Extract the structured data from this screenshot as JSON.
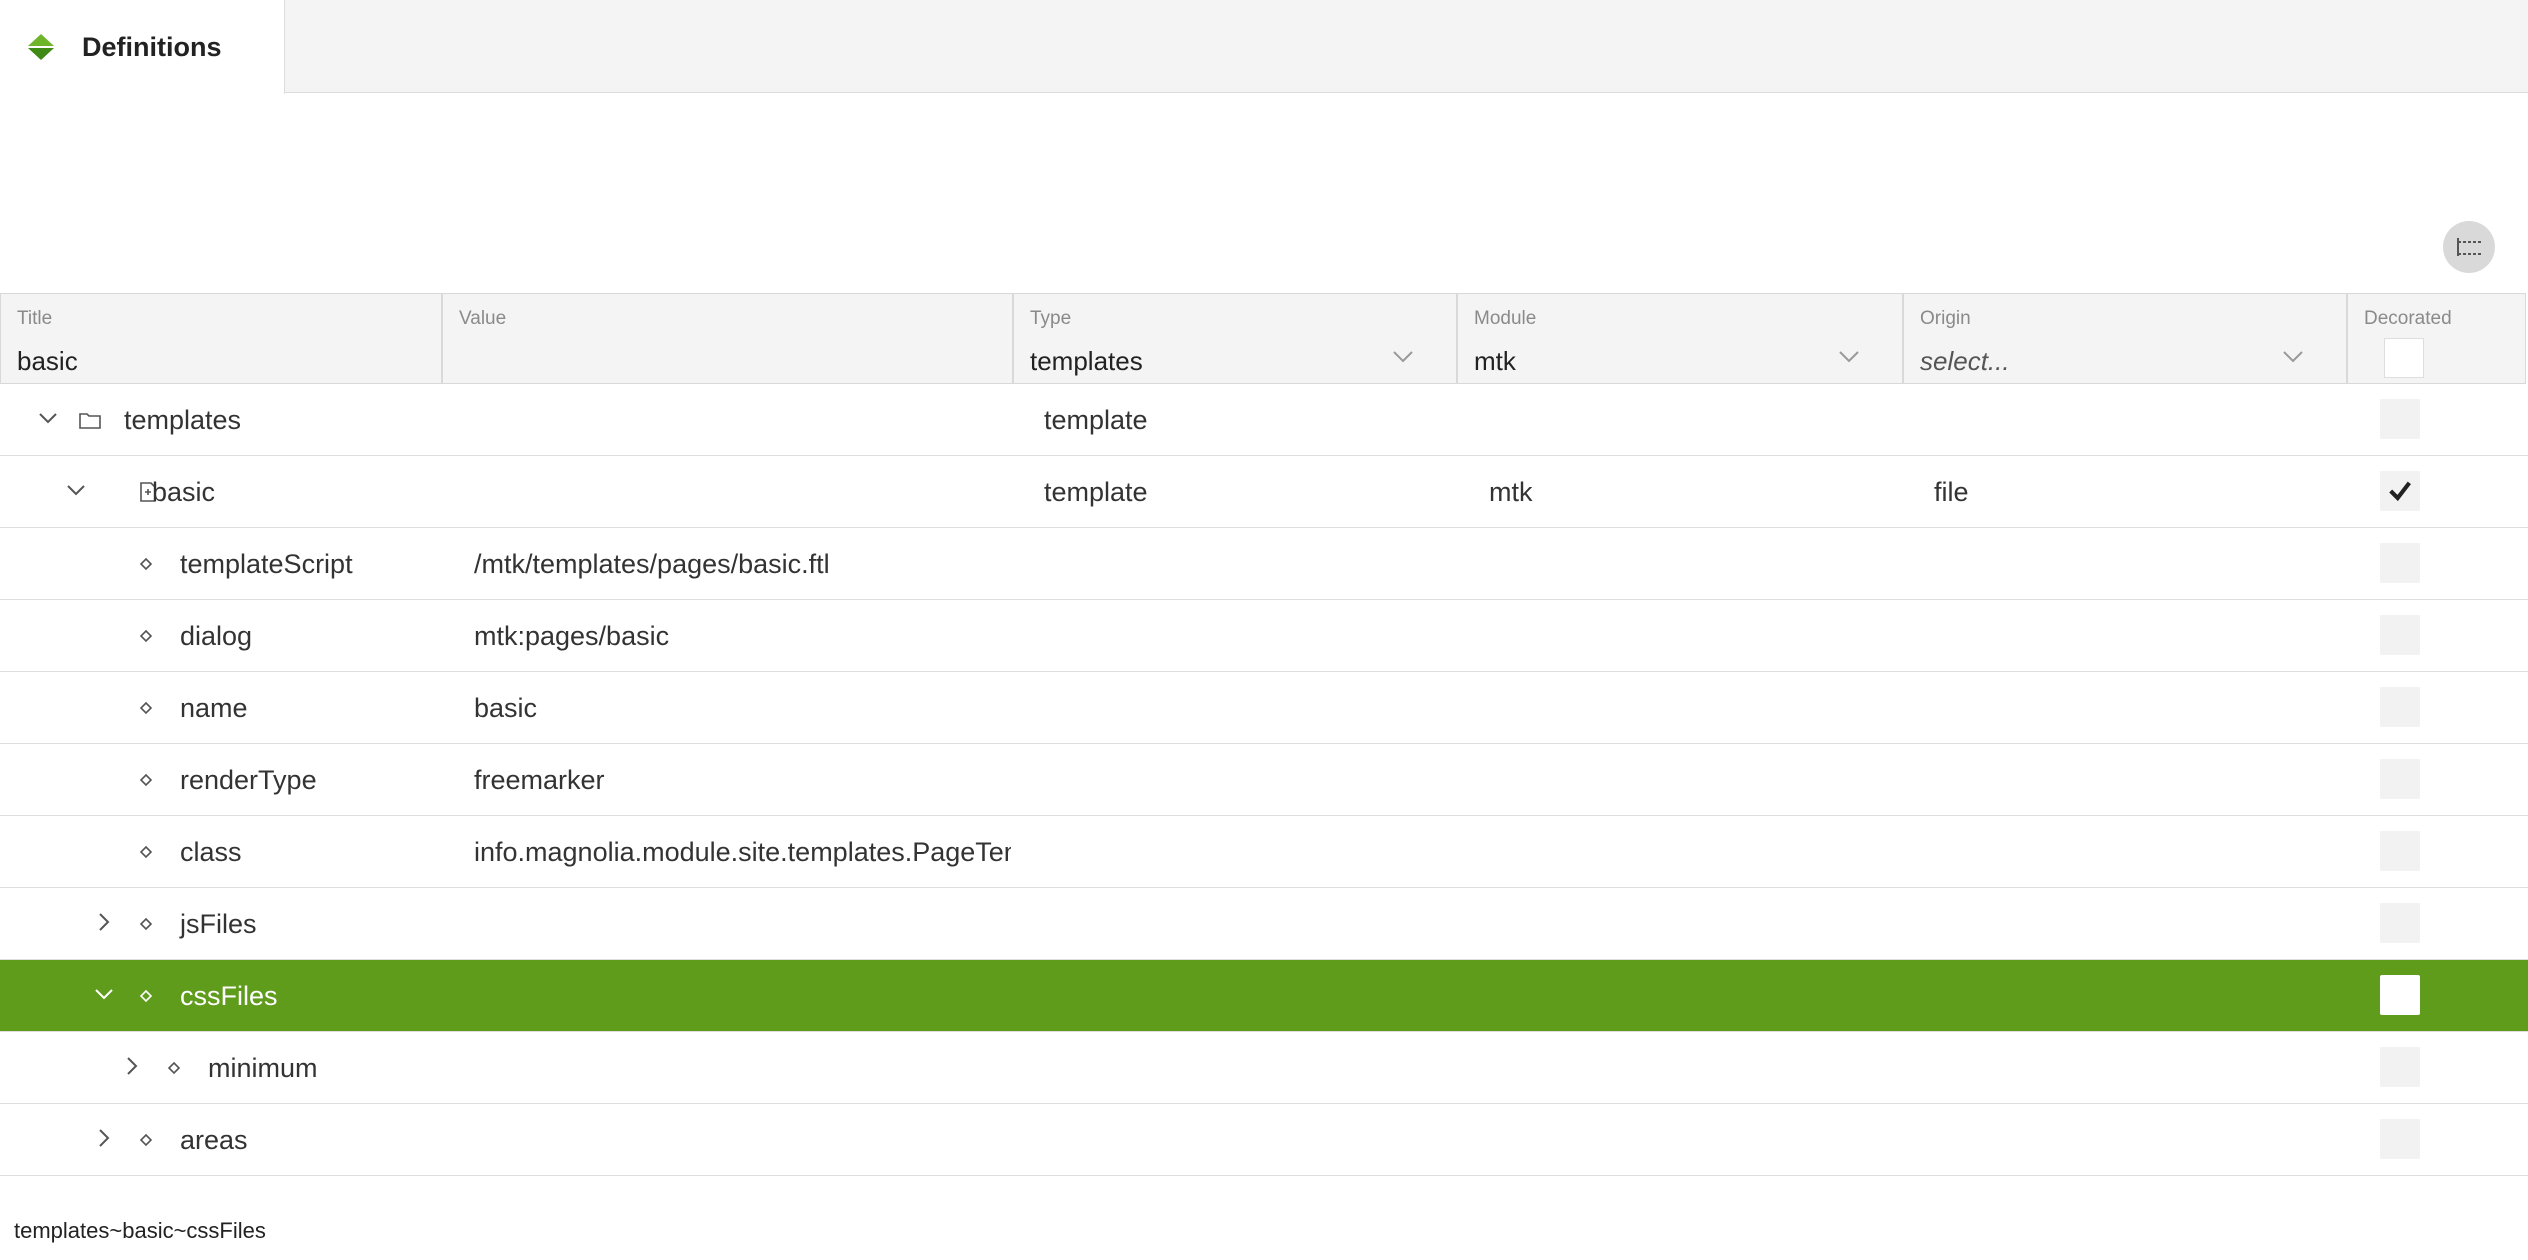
{
  "tab": {
    "label": "Definitions"
  },
  "columns": {
    "title": {
      "label": "Title",
      "filter_value": "basic"
    },
    "value": {
      "label": "Value",
      "filter_value": ""
    },
    "type": {
      "label": "Type",
      "filter_value": "templates"
    },
    "module": {
      "label": "Module",
      "filter_value": "mtk"
    },
    "origin": {
      "label": "Origin",
      "filter_placeholder": "select..."
    },
    "decorated": {
      "label": "Decorated"
    }
  },
  "rows": [
    {
      "title": "templates",
      "value": "",
      "type": "template",
      "module": "",
      "origin": "",
      "decorated": false,
      "level": 0,
      "expander": "expanded",
      "icon": "folder-icon"
    },
    {
      "title": "basic",
      "value": "",
      "type": "template",
      "module": "mtk",
      "origin": "file",
      "decorated": true,
      "level": 1,
      "expander": "expanded",
      "icon": "template-icon"
    },
    {
      "title": "templateScript",
      "value": "/mtk/templates/pages/basic.ftl",
      "type": "",
      "module": "",
      "origin": "",
      "decorated": false,
      "level": 2,
      "expander": "none",
      "icon": "property-icon"
    },
    {
      "title": "dialog",
      "value": "mtk:pages/basic",
      "type": "",
      "module": "",
      "origin": "",
      "decorated": false,
      "level": 2,
      "expander": "none",
      "icon": "property-icon"
    },
    {
      "title": "name",
      "value": "basic",
      "type": "",
      "module": "",
      "origin": "",
      "decorated": false,
      "level": 2,
      "expander": "none",
      "icon": "property-icon"
    },
    {
      "title": "renderType",
      "value": "freemarker",
      "type": "",
      "module": "",
      "origin": "",
      "decorated": false,
      "level": 2,
      "expander": "none",
      "icon": "property-icon"
    },
    {
      "title": "class",
      "value": "info.magnolia.module.site.templates.PageTemplateDefinition",
      "type": "",
      "module": "",
      "origin": "",
      "decorated": false,
      "level": 2,
      "expander": "none",
      "icon": "property-icon"
    },
    {
      "title": "jsFiles",
      "value": "",
      "type": "",
      "module": "",
      "origin": "",
      "decorated": false,
      "level": 2,
      "expander": "collapsed",
      "icon": "property-icon"
    },
    {
      "title": "cssFiles",
      "value": "",
      "type": "",
      "module": "",
      "origin": "",
      "decorated": false,
      "level": 2,
      "expander": "expanded",
      "icon": "property-icon",
      "selected": true
    },
    {
      "title": "minimum",
      "value": "",
      "type": "",
      "module": "",
      "origin": "",
      "decorated": false,
      "level": 3,
      "expander": "collapsed",
      "icon": "property-icon"
    },
    {
      "title": "areas",
      "value": "",
      "type": "",
      "module": "",
      "origin": "",
      "decorated": false,
      "level": 2,
      "expander": "collapsed",
      "icon": "property-icon"
    }
  ],
  "status": {
    "path": "templates~basic~cssFiles"
  },
  "colors": {
    "accent": "#5f9c1c",
    "logo_top": "#6fb52c",
    "logo_bottom": "#3f8a14"
  }
}
